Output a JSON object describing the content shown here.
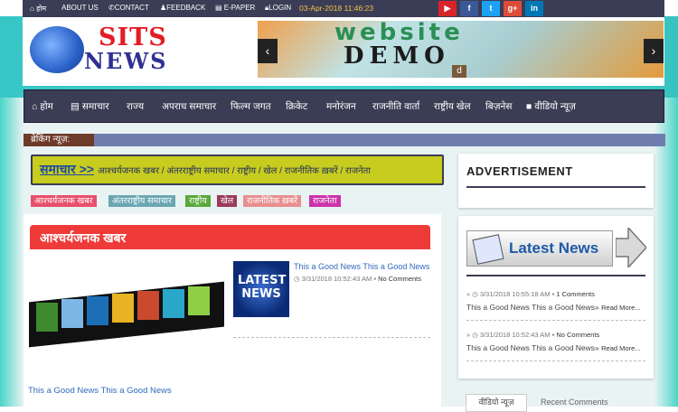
{
  "topbar": {
    "home": "होम",
    "about": "ABOUT US",
    "contact": "CONTACT",
    "feedback": "FEEDBACK",
    "epaper": "E-PAPER",
    "login": "LOGIN",
    "datetime": "03-Apr-2018 11:46:23",
    "social": [
      {
        "name": "youtube-icon",
        "glyph": "▶",
        "color": "#d8252a"
      },
      {
        "name": "facebook-icon",
        "glyph": "f",
        "color": "#3b5998"
      },
      {
        "name": "twitter-icon",
        "glyph": "t",
        "color": "#1da1f2"
      },
      {
        "name": "googleplus-icon",
        "glyph": "g+",
        "color": "#dd4b39"
      },
      {
        "name": "linkedin-icon",
        "glyph": "in",
        "color": "#0077b5"
      }
    ]
  },
  "header": {
    "logo_top": "SITS",
    "logo_bottom": "NEWS",
    "banner_line1": "website",
    "banner_line2": "DEMO",
    "banner_indicator": "d"
  },
  "nav": [
    "होम",
    "समाचार",
    "राज्य",
    "अपराध समाचार",
    "फिल्म जगत",
    "क्रिकेट",
    "मनोरंजन",
    "राजनीति वार्ता",
    "राष्ट्रीय खेल",
    "बिज़नेस",
    "वीडियो न्यूज़"
  ],
  "breaking": {
    "label": "ब्रेकिंग न्यूज़:"
  },
  "samachar": {
    "title": "समाचार >>",
    "links": "आश्चर्यजनक खबर  /  अंतरराष्ट्रीय समाचार  /  राष्ट्रीय  /  खेल  /  राजनीतिक ख़बरें  /  राजनेता"
  },
  "tags": [
    {
      "label": "आश्चर्यजनक खबर",
      "color": "#e8506a"
    },
    {
      "label": "अंतरराष्ट्रीय समाचार",
      "color": "#6aa7b3"
    },
    {
      "label": "राष्ट्रीय",
      "color": "#5aa83a"
    },
    {
      "label": "खेल",
      "color": "#9b3a5a"
    },
    {
      "label": "राजनीतिक ख़बरें",
      "color": "#e88f8f"
    },
    {
      "label": "राजनेता",
      "color": "#cc33aa"
    }
  ],
  "section": {
    "title": "आश्चर्यजनक खबर",
    "thumb_text": "LATEST NEWS",
    "article_title": "This a Good News This a Good News",
    "article_date": "3/31/2018 10:52:43 AM",
    "article_comments": "No Comments",
    "caption": "This a Good News This a Good News"
  },
  "sidebar": {
    "ad_title": "ADVERTISEMENT",
    "latest_banner": "Latest News",
    "items": [
      {
        "date": "3/31/2018 10:55:18 AM",
        "comments": "1 Comments",
        "title": "This a Good News This a Good News",
        "more": "Read More..."
      },
      {
        "date": "3/31/2018 10:52:43 AM",
        "comments": "No Comments",
        "title": "This a Good News This a Good News",
        "more": "Read More..."
      }
    ],
    "bottom_card": "वीडियो न्यूज़",
    "bottom_text": "Recent Comments"
  }
}
